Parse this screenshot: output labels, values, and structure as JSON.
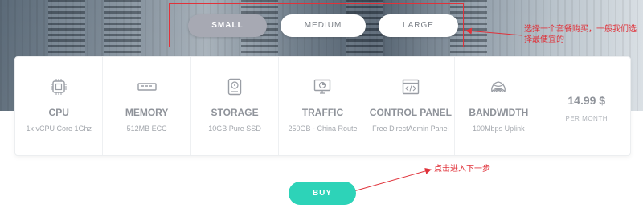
{
  "plans": {
    "options": [
      {
        "label": "SMALL",
        "selected": true
      },
      {
        "label": "MEDIUM",
        "selected": false
      },
      {
        "label": "LARGE",
        "selected": false
      }
    ]
  },
  "annotations": {
    "select_plan": "选择一个套餐购买，一般我们选择最便宜的",
    "next_step": "点击进入下一步"
  },
  "specs": [
    {
      "icon": "cpu-chip-icon",
      "title": "CPU",
      "value": "1x vCPU Core 1Ghz"
    },
    {
      "icon": "memory-module-icon",
      "title": "MEMORY",
      "value": "512MB ECC"
    },
    {
      "icon": "hard-drive-icon",
      "title": "STORAGE",
      "value": "10GB Pure SSD"
    },
    {
      "icon": "monitor-traffic-icon",
      "title": "TRAFFIC",
      "value": "250GB - China Route"
    },
    {
      "icon": "code-window-icon",
      "title": "CONTROL PANEL",
      "value": "Free DirectAdmin Panel"
    },
    {
      "icon": "signal-waves-icon",
      "title": "BANDWIDTH",
      "value": "100Mbps Uplink"
    }
  ],
  "pricing": {
    "price": "14.99 $",
    "period": "PER MONTH"
  },
  "actions": {
    "buy_label": "BUY"
  },
  "colors": {
    "accent": "#2dd3b8",
    "annotation": "#e0323a",
    "selected_plan": "#a7a9b3"
  }
}
